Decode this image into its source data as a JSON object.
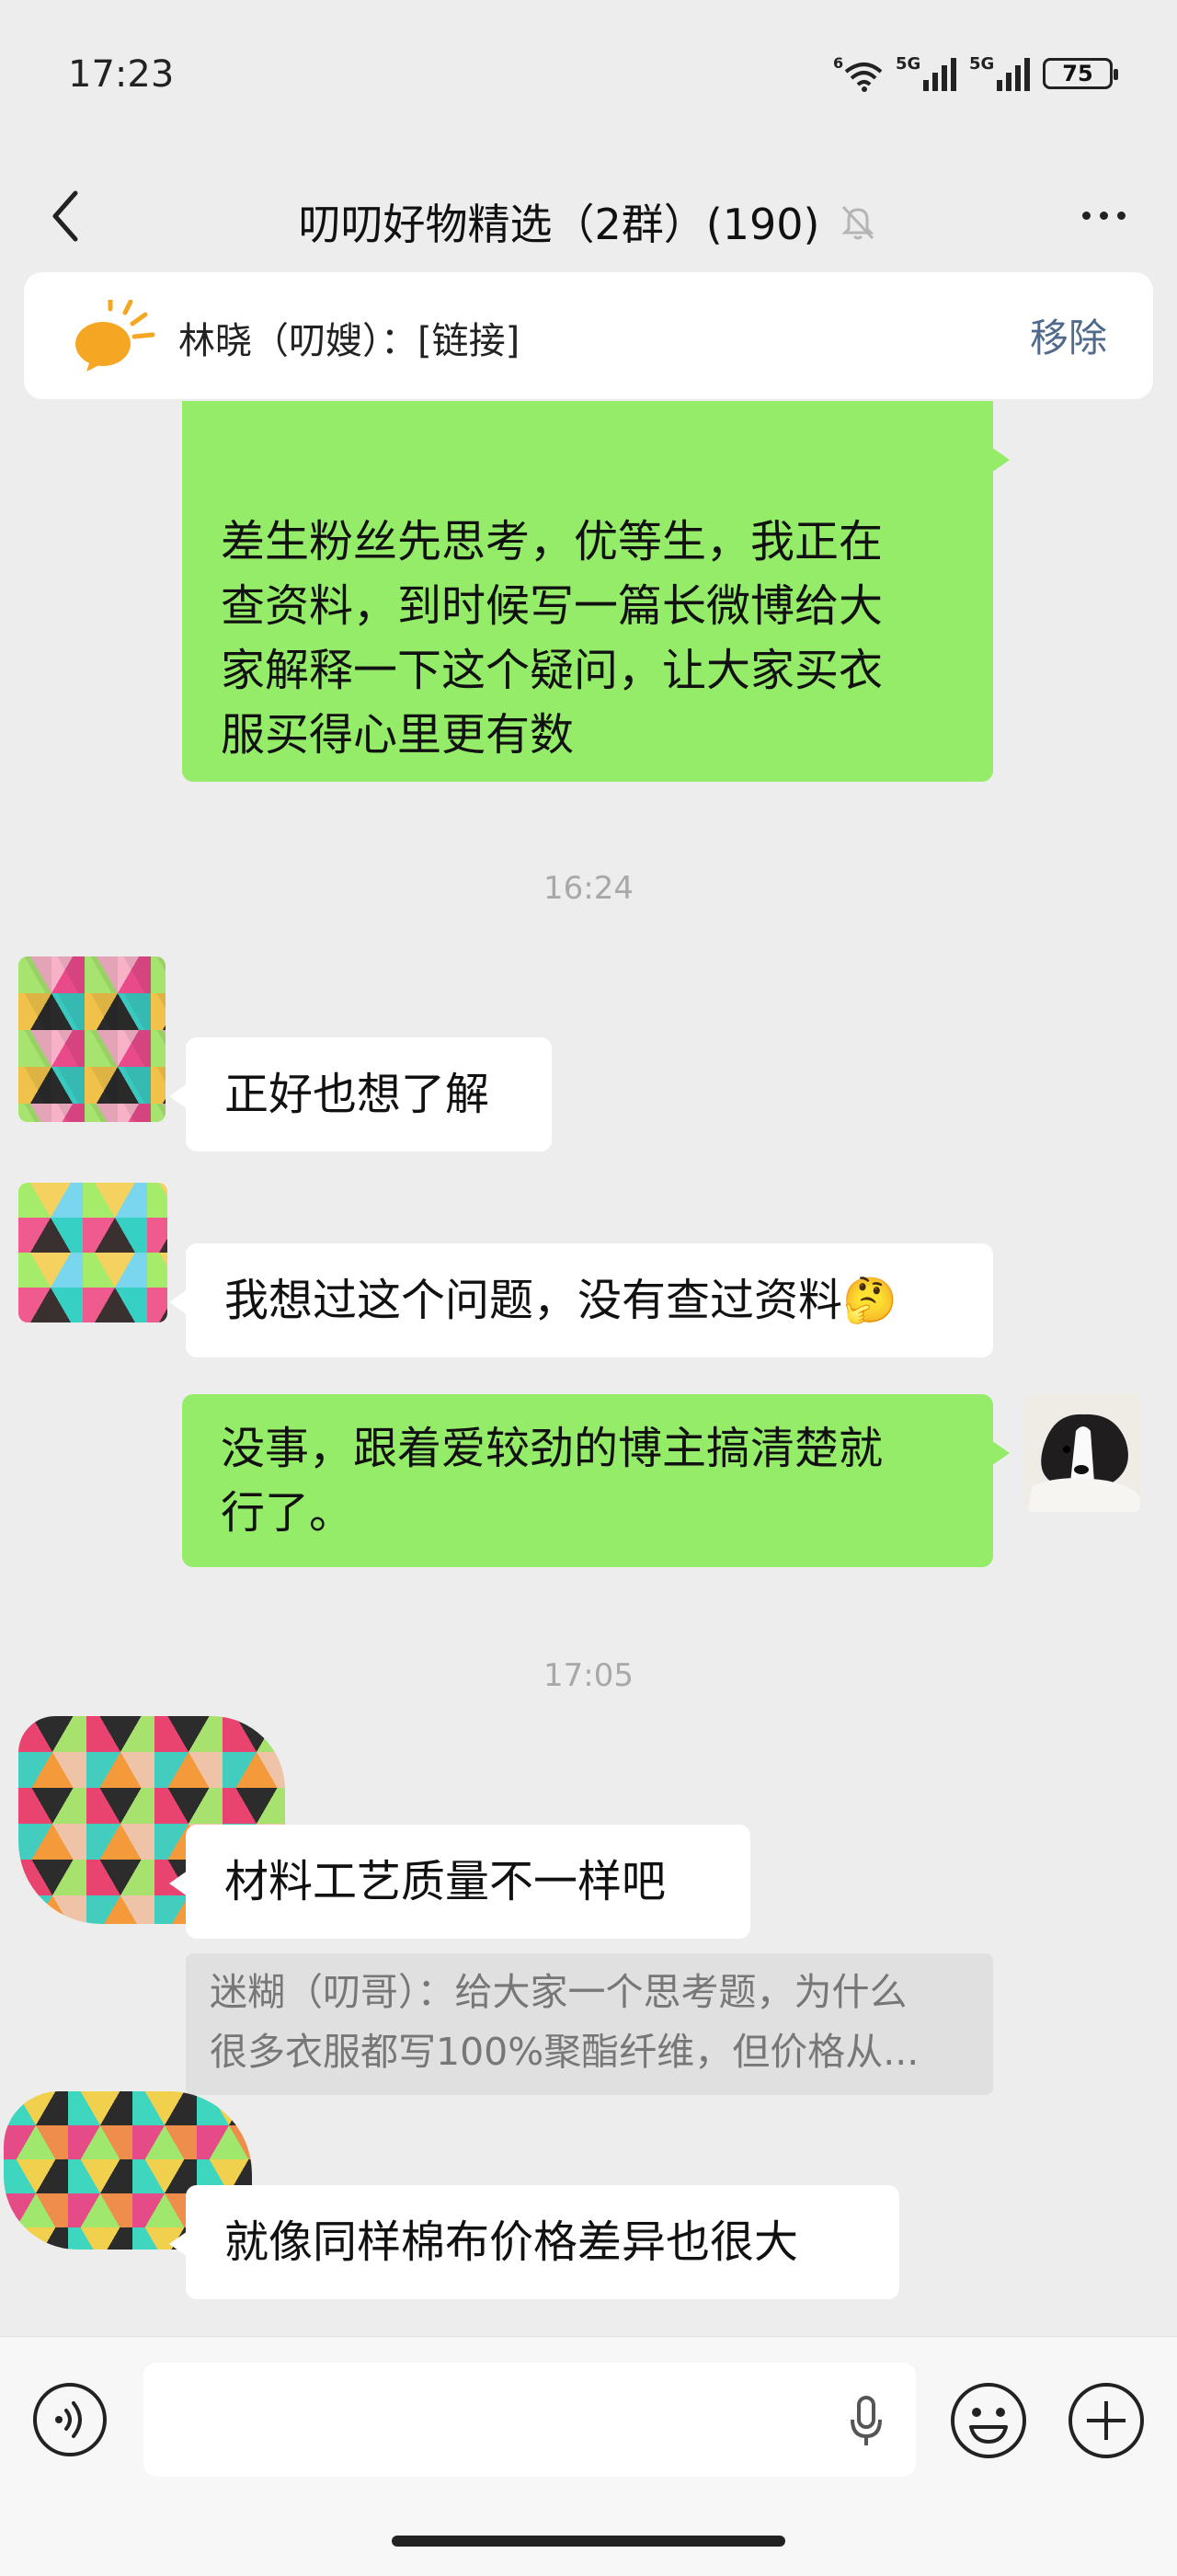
{
  "status_bar": {
    "time": "17:23",
    "wifi_label": "6",
    "sim1_label": "5G",
    "sim2_label": "5G",
    "battery": "75"
  },
  "header": {
    "back_icon": "chevron-left-icon",
    "title": "叨叨好物精选（2群）(190)",
    "muted_icon": "bell-off-icon",
    "more_icon": "more-dots-icon"
  },
  "pinned": {
    "icon": "speaker-icon",
    "text": "林晓（叨嫂）：[链接]",
    "remove_label": "移除",
    "accent": "#f5a623"
  },
  "messages": {
    "m1": {
      "text": "差生粉丝先思考，优等生，我正在\n查资料，到时候写一篇长微博给大\n家解释一下这个疑问，让大家买衣\n服买得心里更有数"
    },
    "ts1": "16:24",
    "m2": {
      "text": "正好也想了解"
    },
    "m3": {
      "text": "我想过这个问题，没有查过资料🤔"
    },
    "m4": {
      "text": "没事，跟着爱较劲的博主搞清楚就\n行了。"
    },
    "ts2": "17:05",
    "m5": {
      "text": "材料工艺质量不一样吧"
    },
    "quote": {
      "line1": "迷糊（叨哥）：给大家一个思考题，为什么",
      "line2": "很多衣服都写100%聚酯纤维，但价格从..."
    },
    "m6": {
      "text": "就像同样棉布价格差异也很大"
    }
  },
  "input_bar": {
    "voice_icon": "voice-icon",
    "mic_icon": "mic-icon",
    "emoji_icon": "emoji-icon",
    "plus_icon": "plus-icon"
  },
  "colors": {
    "background": "#ededed",
    "my_bubble": "#95ec69",
    "other_bubble": "#ffffff",
    "link": "#506a8c"
  }
}
